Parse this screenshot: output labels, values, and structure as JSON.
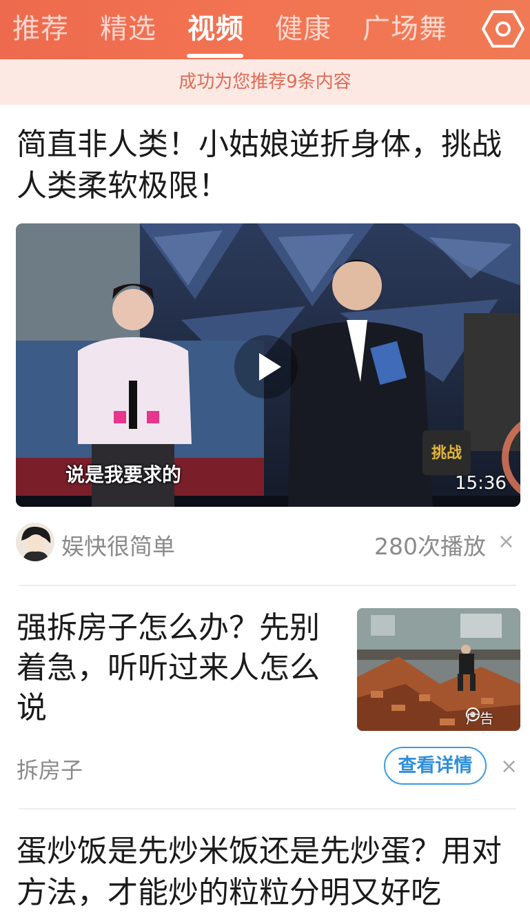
{
  "tabs": [
    {
      "label": "推荐",
      "active": false
    },
    {
      "label": "精选",
      "active": false
    },
    {
      "label": "视频",
      "active": true
    },
    {
      "label": "健康",
      "active": false
    },
    {
      "label": "广场舞",
      "active": false
    }
  ],
  "settings_icon": "hexagon-settings-icon",
  "banner": "成功为您推荐9条内容",
  "article1": {
    "title": "简直非人类！小姑娘逆折身体，挑战人类柔软极限！",
    "video_subtitle": "说是我要求的",
    "duration": "15:36",
    "author": "娱快很简单",
    "plays": "280次播放",
    "close": "×"
  },
  "article2": {
    "title": "强拆房子怎么办？先别着急，听听过来人怎么说",
    "ad_label": "广告",
    "tag": "拆房子",
    "detail_button": "查看详情",
    "close": "×"
  },
  "article3": {
    "title": "蛋炒饭是先炒米饭还是先炒蛋？用对方法，才能炒的粒粒分明又好吃"
  },
  "colors": {
    "topbar": "#f07052",
    "banner_bg": "#fde9e4",
    "banner_text": "#e06a55",
    "detail_button": "#2f8fdb"
  }
}
